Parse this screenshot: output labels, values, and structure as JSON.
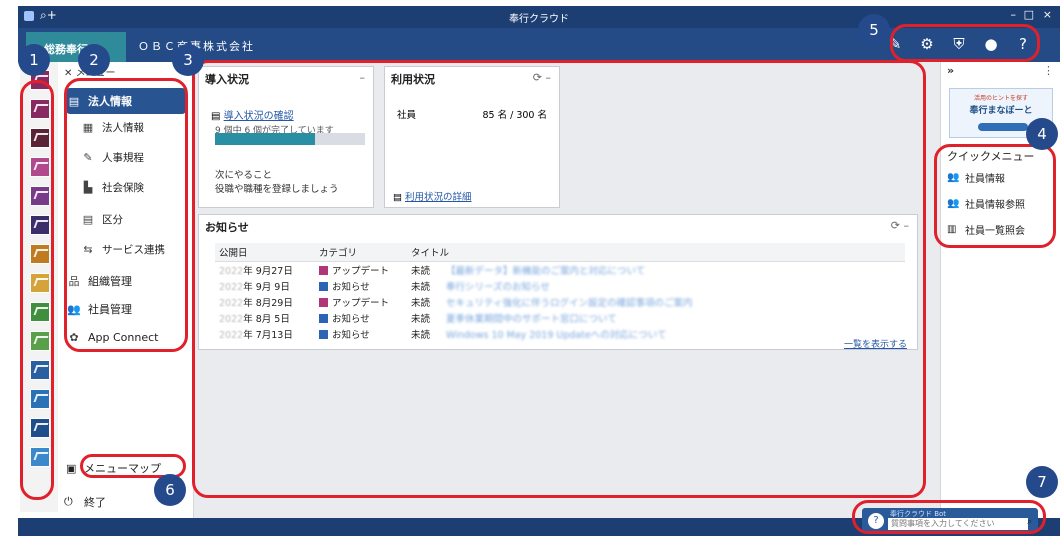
{
  "window": {
    "title": "奉行クラウド",
    "search_glyph": "⌕+",
    "btn_min": "–",
    "btn_max": "□",
    "btn_close": "×"
  },
  "header": {
    "active_tab": "総務奉行",
    "company": "ＯＢＣ商事株式会社",
    "icons": [
      "edit-icon",
      "gear-icon",
      "shield-icon",
      "user-icon",
      "help-icon"
    ]
  },
  "app_strip": {
    "colors": [
      "#8a2a63",
      "#8a2a63",
      "#5b2436",
      "#b04a8c",
      "#7a3a8a",
      "#3b2e6a",
      "#c07a20",
      "#d4a33a",
      "#3f8f3f",
      "#5aa04a",
      "#2a5fa0",
      "#2a72b8",
      "#1f4f8a",
      "#3a8acb"
    ]
  },
  "menu": {
    "head": "メニュー",
    "items": [
      {
        "label": "法人情報",
        "icon": "▤"
      },
      {
        "label": "法人情報",
        "icon": "▦"
      },
      {
        "label": "人事規程",
        "icon": "✎"
      },
      {
        "label": "社会保険",
        "icon": "▙"
      },
      {
        "label": "区分",
        "icon": "▤"
      },
      {
        "label": "サービス連携",
        "icon": "⇆"
      },
      {
        "label": "組織管理",
        "icon": "品"
      },
      {
        "label": "社員管理",
        "icon": "👥"
      },
      {
        "label": "App Connect",
        "icon": "✿"
      }
    ],
    "menumap": "メニューマップ",
    "exit": "終了"
  },
  "intro": {
    "title": "導入状況",
    "link": "導入状況の確認",
    "progress_text": "9 個中 6 個が完了しています",
    "progress_ratio": 0.6667,
    "next_title": "次にやること",
    "next_text": "役職や職種を登録しましょう"
  },
  "usage": {
    "title": "利用状況",
    "row_label": "社員",
    "row_value": "85 名 / 300 名",
    "link": "利用状況の詳細"
  },
  "news": {
    "title": "お知らせ",
    "headers": [
      "公開日",
      "カテゴリ",
      "タイトル"
    ],
    "rows": [
      {
        "year": "2022",
        "date": "年 9月27日",
        "cat": "アップデート",
        "cat_color": "#b0367a",
        "status": "未読",
        "title": "【最新データ】新機能のご案内と対応について"
      },
      {
        "year": "2022",
        "date": "年 9月 9日",
        "cat": "お知らせ",
        "cat_color": "#2c63b5",
        "status": "未読",
        "title": "奉行シリーズのお知らせ"
      },
      {
        "year": "2022",
        "date": "年 8月29日",
        "cat": "アップデート",
        "cat_color": "#b0367a",
        "status": "未読",
        "title": "セキュリティ強化に伴うログイン設定の確認事項のご案内"
      },
      {
        "year": "2022",
        "date": "年 8月 5日",
        "cat": "お知らせ",
        "cat_color": "#2c63b5",
        "status": "未読",
        "title": "夏季休業期間中のサポート窓口について"
      },
      {
        "year": "2022",
        "date": "年 7月13日",
        "cat": "お知らせ",
        "cat_color": "#2c63b5",
        "status": "未読",
        "title": "Windows 10 May 2019 Updateへの対応について"
      }
    ],
    "more": "一覧を表示する"
  },
  "right": {
    "banner_line1": "活用のヒントを探す",
    "banner_line2": "奉行まなぼーと",
    "quick_title": "クイックメニュー",
    "quick_items": [
      {
        "label": "社員情報",
        "icon": "👥"
      },
      {
        "label": "社員情報参照",
        "icon": "👥"
      },
      {
        "label": "社員一覧照会",
        "icon": "▥"
      }
    ]
  },
  "bot": {
    "label": "奉行クラウド Bot",
    "placeholder": "質問事項を入力してください"
  },
  "annotations": [
    "1",
    "2",
    "3",
    "4",
    "5",
    "6",
    "7"
  ]
}
